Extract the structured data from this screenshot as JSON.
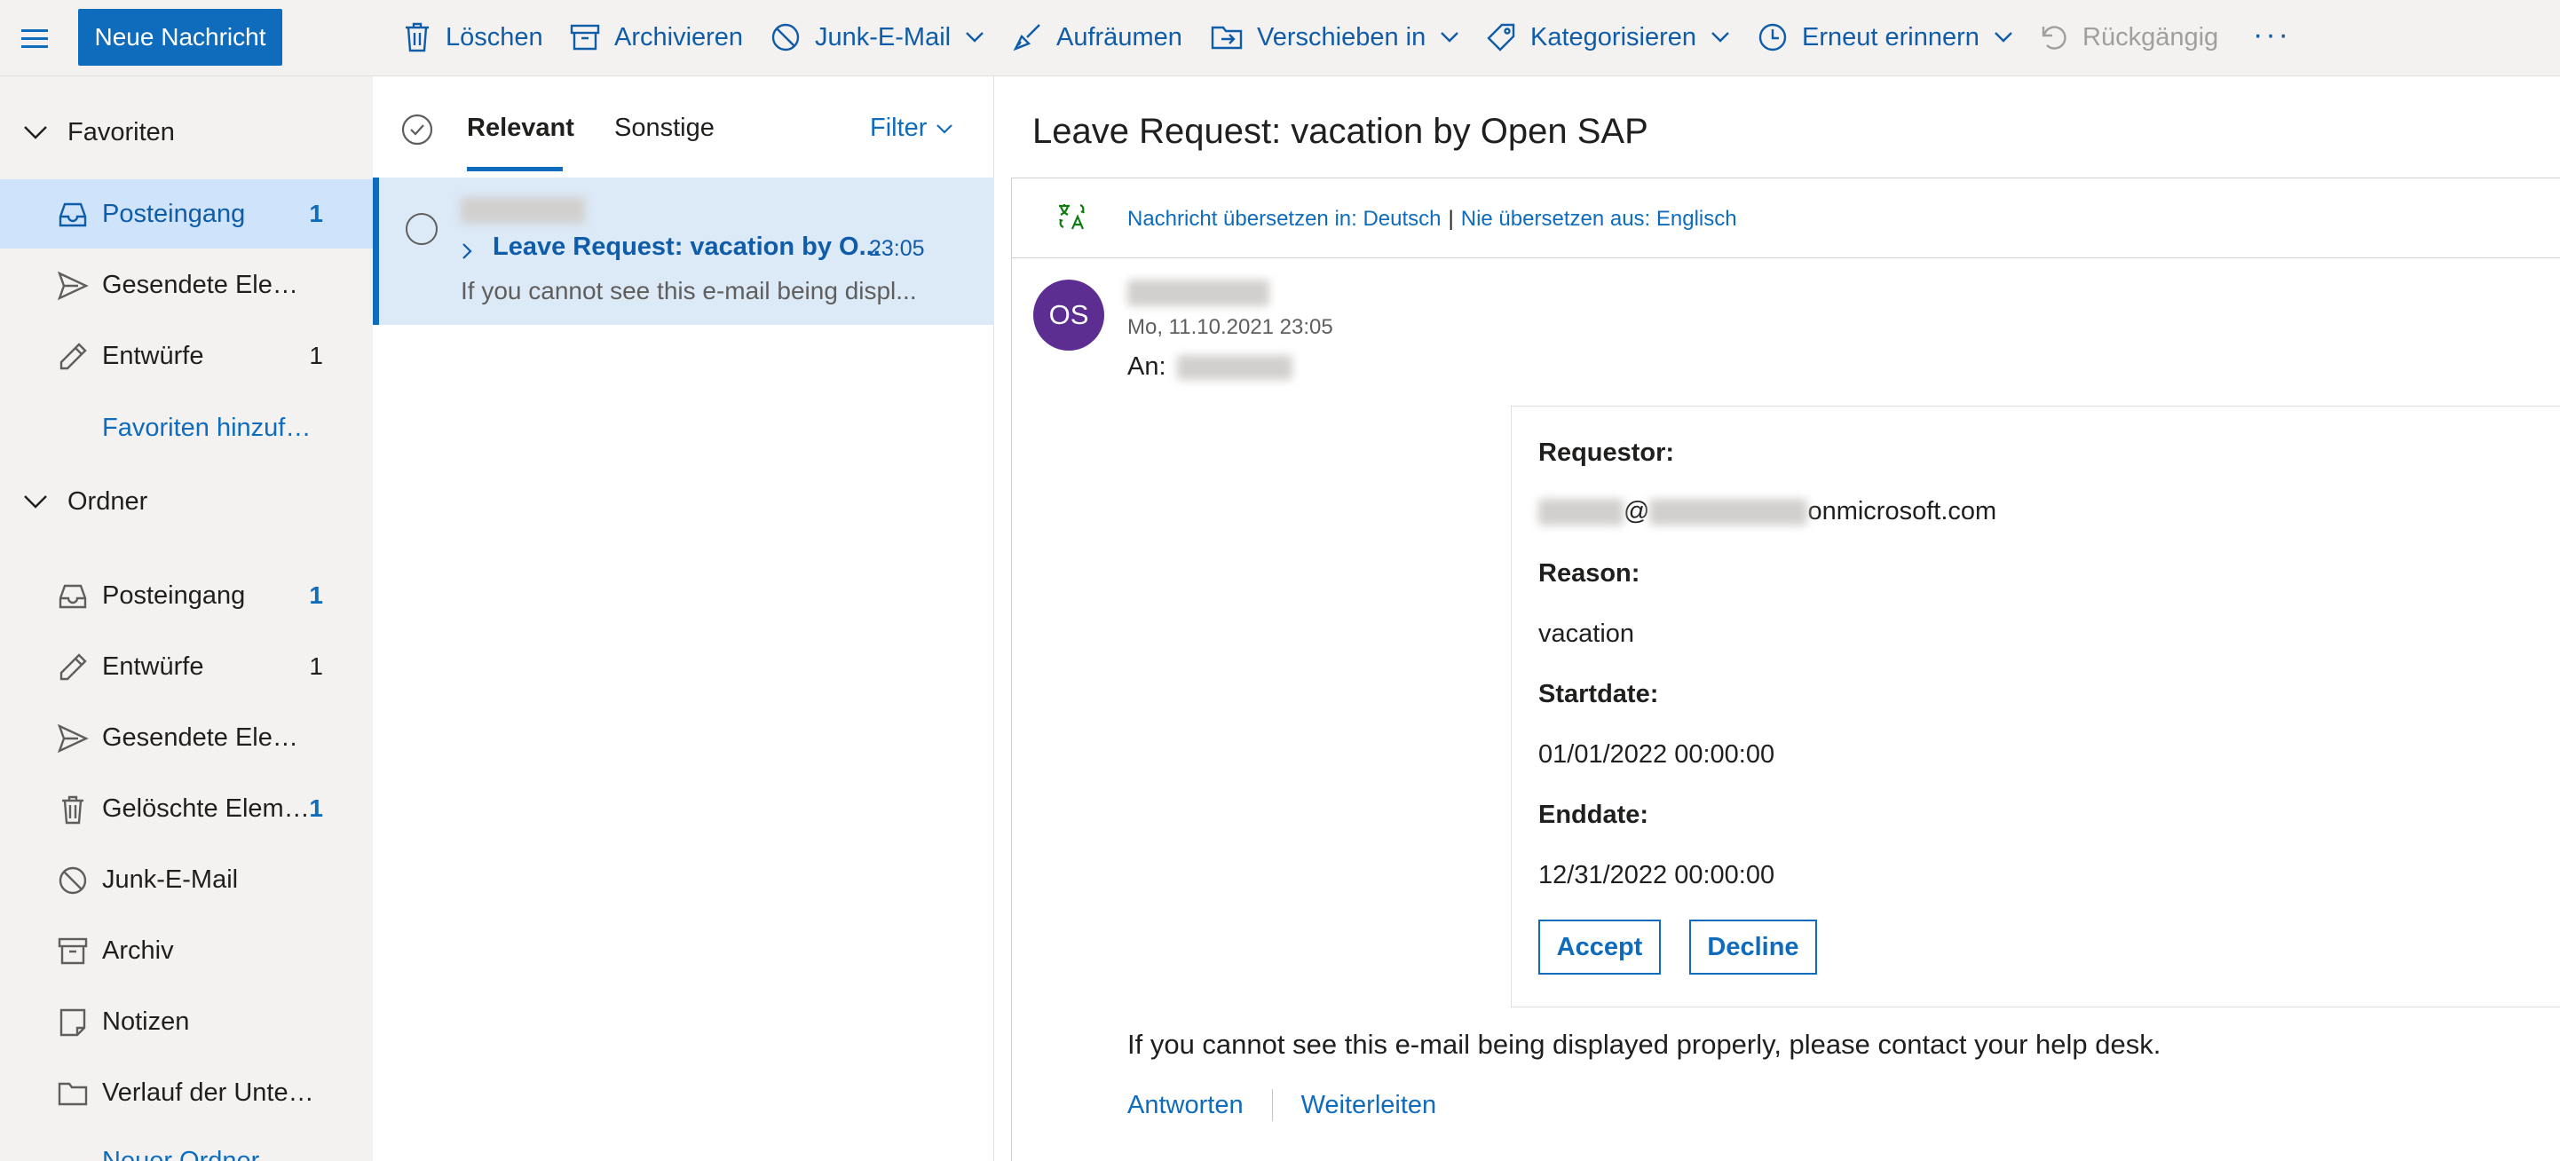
{
  "toolbar": {
    "new_message": "Neue Nachricht",
    "delete": "Löschen",
    "archive": "Archivieren",
    "junk": "Junk-E-Mail",
    "sweep": "Aufräumen",
    "move_to": "Verschieben in",
    "categorize": "Kategorisieren",
    "snooze": "Erneut erinnern",
    "undo": "Rückgängig",
    "more": "···"
  },
  "nav": {
    "favorites": {
      "title": "Favoriten",
      "items": [
        {
          "label": "Posteingang",
          "count": "1"
        },
        {
          "label": "Gesendete Elemente",
          "count": ""
        },
        {
          "label": "Entwürfe",
          "count": "1"
        }
      ],
      "add_link": "Favoriten hinzufügen"
    },
    "folders": {
      "title": "Ordner",
      "items": [
        {
          "label": "Posteingang",
          "count": "1"
        },
        {
          "label": "Entwürfe",
          "count": "1"
        },
        {
          "label": "Gesendete Elemente",
          "count": ""
        },
        {
          "label": "Gelöschte Elemente",
          "count": "1"
        },
        {
          "label": "Junk-E-Mail",
          "count": ""
        },
        {
          "label": "Archiv",
          "count": ""
        },
        {
          "label": "Notizen",
          "count": ""
        },
        {
          "label": "Verlauf der Unterhaltung",
          "count": ""
        }
      ],
      "new_folder_link": "Neuer Ordner"
    }
  },
  "message_list": {
    "tabs": [
      "Relevant",
      "Sonstige"
    ],
    "filter": "Filter",
    "messages": [
      {
        "subject": "Leave Request: vacation by O...",
        "time": "23:05",
        "preview": "If you cannot see this e-mail being displ..."
      }
    ]
  },
  "reading_pane": {
    "subject": "Leave Request: vacation by Open SAP",
    "translate": {
      "translate_to": "Nachricht übersetzen in: Deutsch",
      "separator": "|",
      "never_translate": "Nie übersetzen aus: Englisch"
    },
    "avatar_initials": "OS",
    "date": "Mo, 11.10.2021 23:05",
    "to_label": "An:",
    "body": {
      "requestor_label": "Requestor:",
      "at_sign": "@",
      "email_domain": "onmicrosoft.com",
      "reason_label": "Reason:",
      "reason_value": "vacation",
      "startdate_label": "Startdate:",
      "startdate_value": "01/01/2022 00:00:00",
      "enddate_label": "Enddate:",
      "enddate_value": "12/31/2022 00:00:00",
      "accept": "Accept",
      "decline": "Decline"
    },
    "footer_text": "If you cannot see this e-mail being displayed properly, please contact your help desk.",
    "reply": "Antworten",
    "forward": "Weiterleiten"
  },
  "colors": {
    "accent": "#0f6cbd",
    "selected_nav": "#cfe4fa",
    "selected_message": "#dce9f7",
    "avatar": "#5c2e91",
    "pane_background": "#f3f2f1"
  }
}
